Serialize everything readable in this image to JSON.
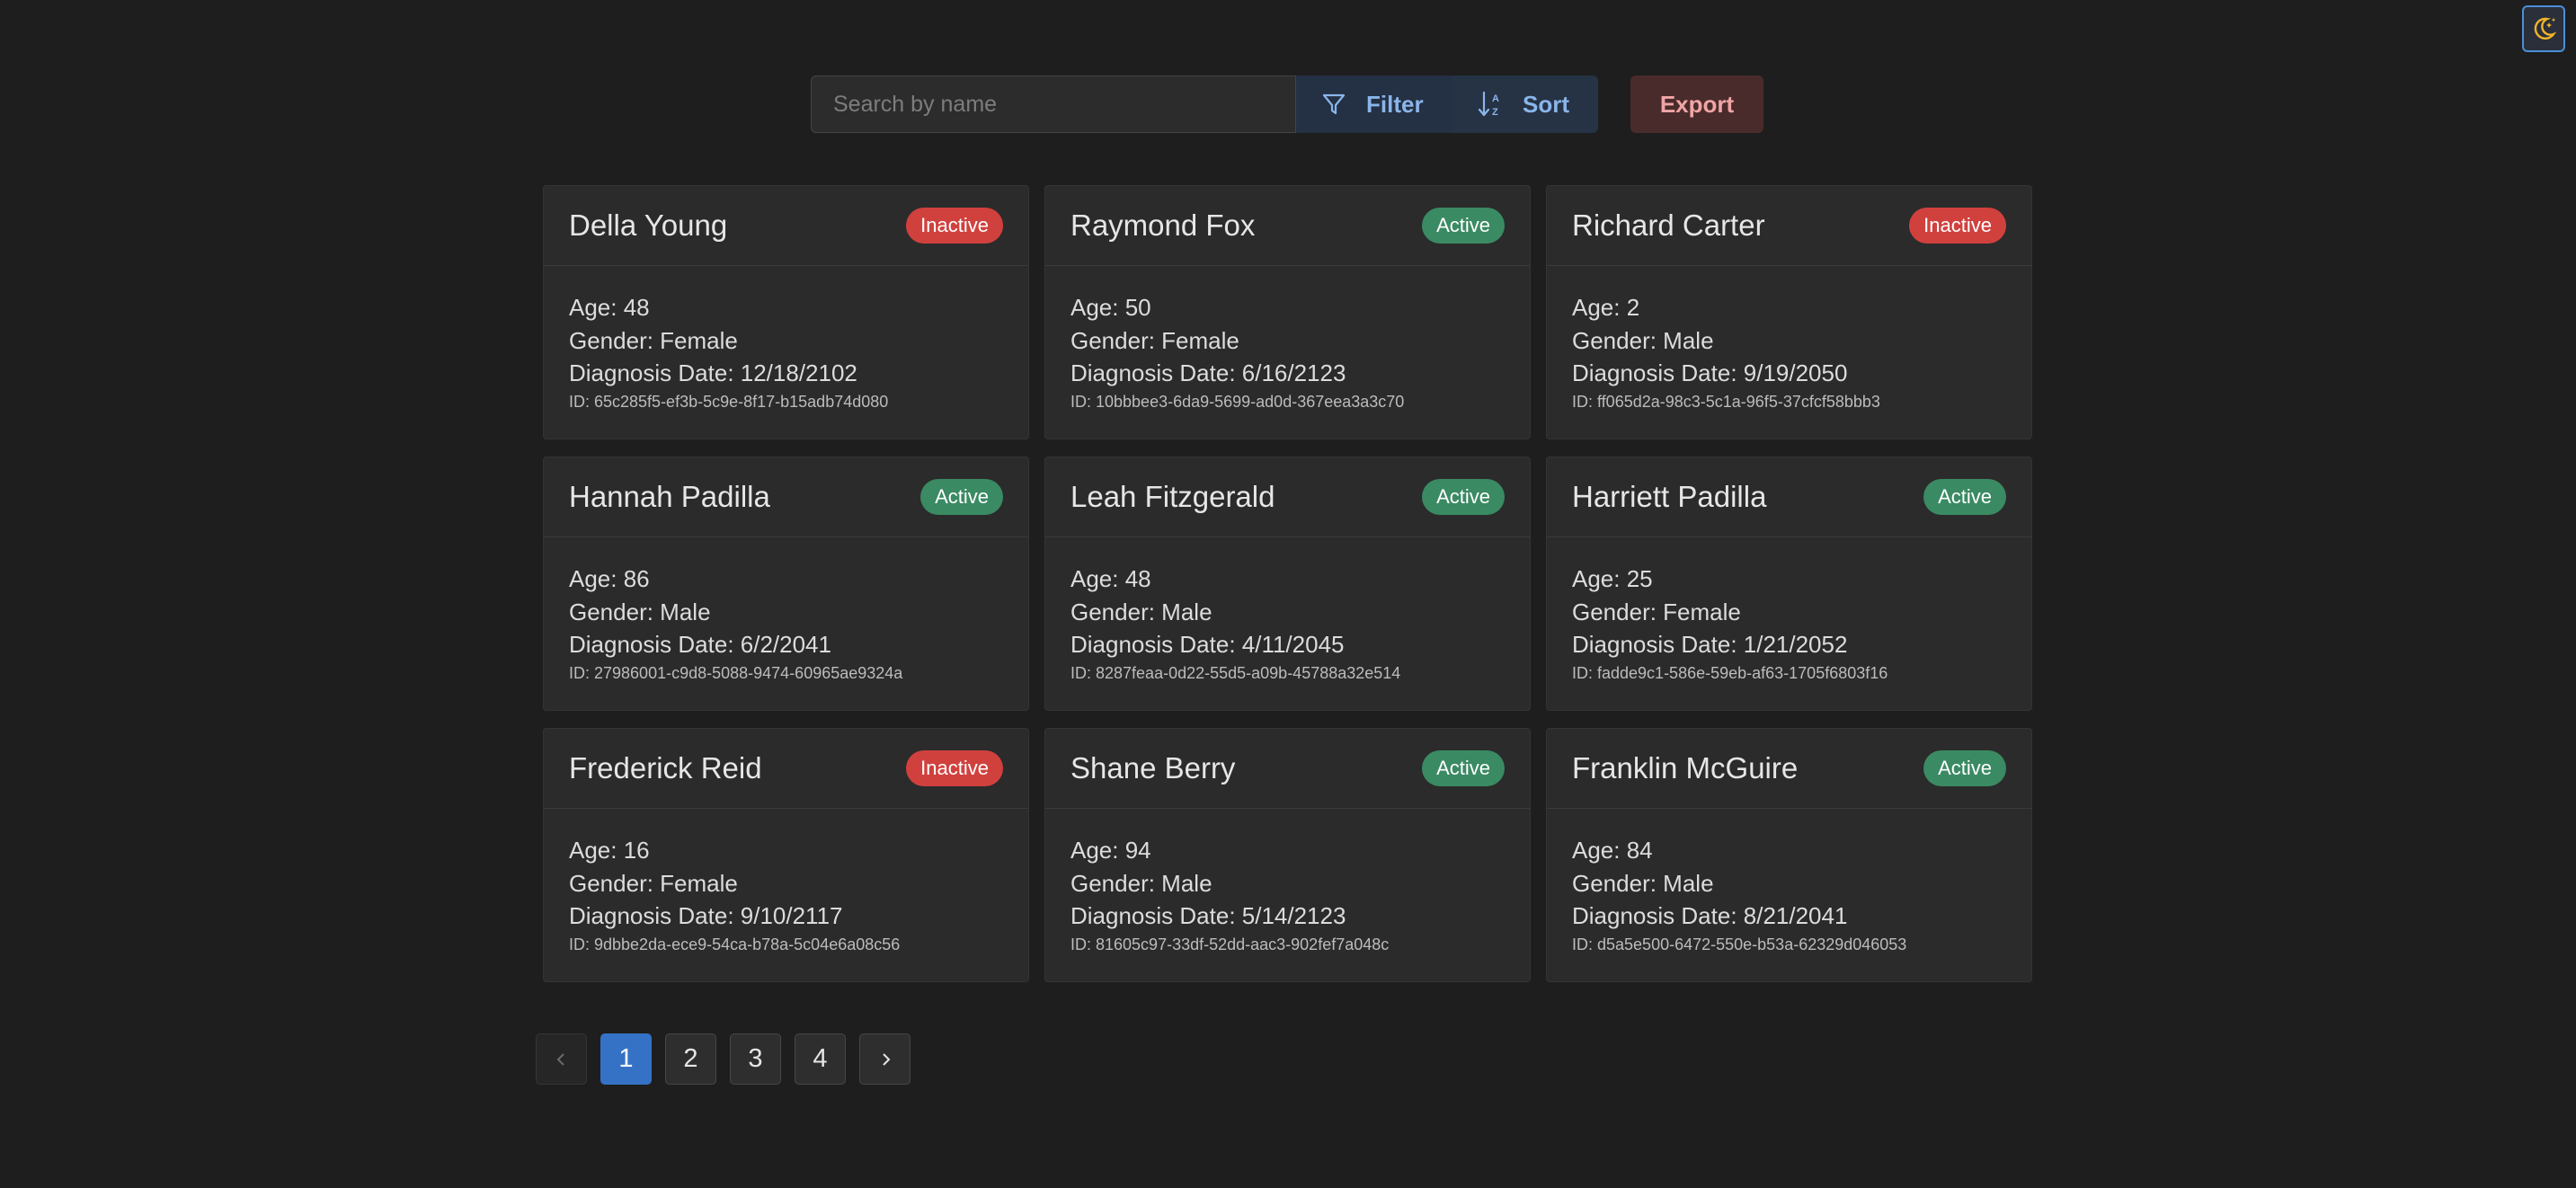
{
  "toolbar": {
    "search_placeholder": "Search by name",
    "search_value": "",
    "filter_label": "Filter",
    "sort_label": "Sort",
    "export_label": "Export"
  },
  "theme_toggle": {
    "icon": "moon-stars-icon"
  },
  "patients": [
    {
      "name": "Della Young",
      "status": "Inactive",
      "age": "Age: 48",
      "gender": "Gender: Female",
      "diagnosis": "Diagnosis Date: 12/18/2102",
      "id": "ID: 65c285f5-ef3b-5c9e-8f17-b15adb74d080"
    },
    {
      "name": "Raymond Fox",
      "status": "Active",
      "age": "Age: 50",
      "gender": "Gender: Female",
      "diagnosis": "Diagnosis Date: 6/16/2123",
      "id": "ID: 10bbbee3-6da9-5699-ad0d-367eea3a3c70"
    },
    {
      "name": "Richard Carter",
      "status": "Inactive",
      "age": "Age: 2",
      "gender": "Gender: Male",
      "diagnosis": "Diagnosis Date: 9/19/2050",
      "id": "ID: ff065d2a-98c3-5c1a-96f5-37cfcf58bbb3"
    },
    {
      "name": "Hannah Padilla",
      "status": "Active",
      "age": "Age: 86",
      "gender": "Gender: Male",
      "diagnosis": "Diagnosis Date: 6/2/2041",
      "id": "ID: 27986001-c9d8-5088-9474-60965ae9324a"
    },
    {
      "name": "Leah Fitzgerald",
      "status": "Active",
      "age": "Age: 48",
      "gender": "Gender: Male",
      "diagnosis": "Diagnosis Date: 4/11/2045",
      "id": "ID: 8287feaa-0d22-55d5-a09b-45788a32e514"
    },
    {
      "name": "Harriett Padilla",
      "status": "Active",
      "age": "Age: 25",
      "gender": "Gender: Female",
      "diagnosis": "Diagnosis Date: 1/21/2052",
      "id": "ID: fadde9c1-586e-59eb-af63-1705f6803f16"
    },
    {
      "name": "Frederick Reid",
      "status": "Inactive",
      "age": "Age: 16",
      "gender": "Gender: Female",
      "diagnosis": "Diagnosis Date: 9/10/2117",
      "id": "ID: 9dbbe2da-ece9-54ca-b78a-5c04e6a08c56"
    },
    {
      "name": "Shane Berry",
      "status": "Active",
      "age": "Age: 94",
      "gender": "Gender: Male",
      "diagnosis": "Diagnosis Date: 5/14/2123",
      "id": "ID: 81605c97-33df-52dd-aac3-902fef7a048c"
    },
    {
      "name": "Franklin McGuire",
      "status": "Active",
      "age": "Age: 84",
      "gender": "Gender: Male",
      "diagnosis": "Diagnosis Date: 8/21/2041",
      "id": "ID: d5a5e500-6472-550e-b53a-62329d046053"
    }
  ],
  "pagination": {
    "pages": [
      "1",
      "2",
      "3",
      "4"
    ],
    "current": "1",
    "prev_icon": "chevron-left-icon",
    "next_icon": "chevron-right-icon"
  },
  "colors": {
    "active": "#3a8a63",
    "inactive": "#d0413e",
    "accent": "#3572c6"
  }
}
